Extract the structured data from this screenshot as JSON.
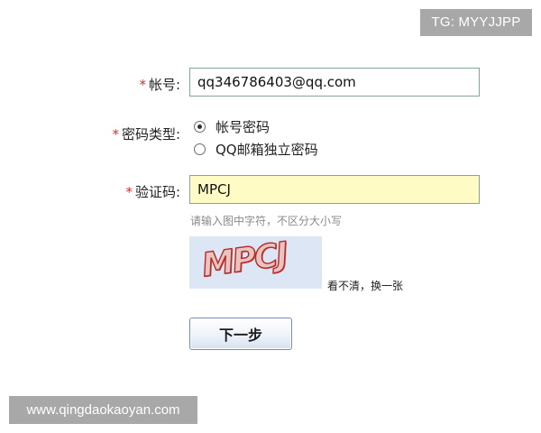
{
  "watermarks": {
    "top": "TG: MYYJJPP",
    "bottom": "www.qingdaokaoyan.com"
  },
  "form": {
    "required_mark": "*",
    "account": {
      "label": "帐号:",
      "value": "qq346786403@qq.com"
    },
    "password_type": {
      "label": "密码类型:",
      "options": [
        {
          "label": "帐号密码",
          "checked": true
        },
        {
          "label": "QQ邮箱独立密码",
          "checked": false
        }
      ]
    },
    "captcha": {
      "label": "验证码:",
      "value": "MPCJ",
      "hint": "请输入图中字符，不区分大小写",
      "image_text": "MPCJ",
      "refresh_link": "看不清，换一张"
    },
    "next_button": "下一步"
  },
  "colors": {
    "required": "#d9302c",
    "captcha_input_bg": "#fffbc4",
    "input_border": "#86a39e",
    "captcha_image_bg": "#dde6f4",
    "captcha_glyph": "#b52a26",
    "watermark_bg": "#a8a8a8"
  }
}
